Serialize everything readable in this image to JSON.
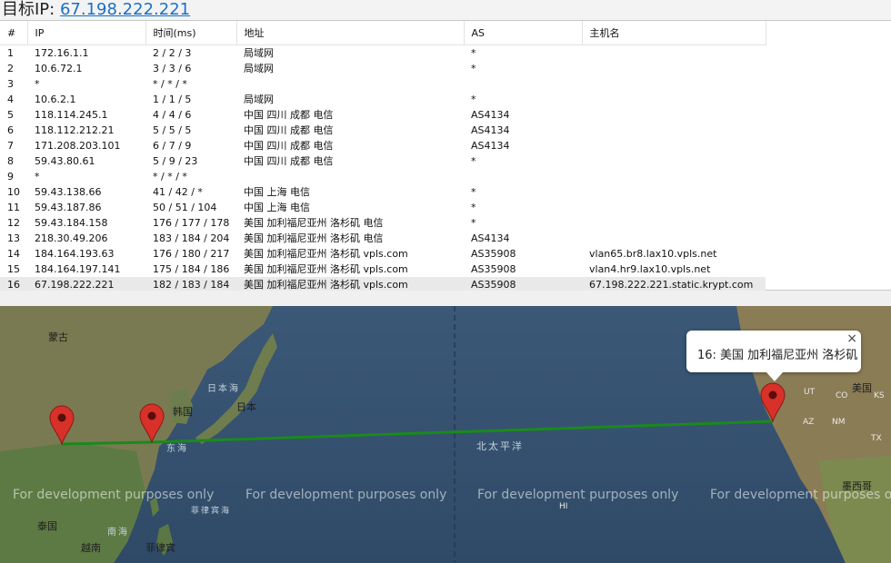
{
  "header": {
    "label": "目标IP:",
    "ip": "67.198.222.221"
  },
  "table": {
    "columns": [
      "#",
      "IP",
      "时间(ms)",
      "地址",
      "AS",
      "主机名"
    ],
    "rows": [
      [
        "1",
        "172.16.1.1",
        "2 / 2 / 3",
        "局域网",
        "*",
        ""
      ],
      [
        "2",
        "10.6.72.1",
        "3 / 3 / 6",
        "局域网",
        "*",
        ""
      ],
      [
        "3",
        "*",
        "* / * / *",
        "",
        "",
        ""
      ],
      [
        "4",
        "10.6.2.1",
        "1 / 1 / 5",
        "局域网",
        "*",
        ""
      ],
      [
        "5",
        "118.114.245.1",
        "4 / 4 / 6",
        "中国 四川 成都 电信",
        "AS4134",
        ""
      ],
      [
        "6",
        "118.112.212.21",
        "5 / 5 / 5",
        "中国 四川 成都 电信",
        "AS4134",
        ""
      ],
      [
        "7",
        "171.208.203.101",
        "6 / 7 / 9",
        "中国 四川 成都 电信",
        "AS4134",
        ""
      ],
      [
        "8",
        "59.43.80.61",
        "5 / 9 / 23",
        "中国 四川 成都 电信",
        "*",
        ""
      ],
      [
        "9",
        "*",
        "* / * / *",
        "",
        "",
        ""
      ],
      [
        "10",
        "59.43.138.66",
        "41 / 42 / *",
        "中国 上海 电信",
        "*",
        ""
      ],
      [
        "11",
        "59.43.187.86",
        "50 / 51 / 104",
        "中国 上海 电信",
        "*",
        ""
      ],
      [
        "12",
        "59.43.184.158",
        "176 / 177 / 178",
        "美国 加利福尼亚州 洛杉矶 电信",
        "*",
        ""
      ],
      [
        "13",
        "218.30.49.206",
        "183 / 184 / 204",
        "美国 加利福尼亚州 洛杉矶 电信",
        "AS4134",
        ""
      ],
      [
        "14",
        "184.164.193.63",
        "176 / 180 / 217",
        "美国 加利福尼亚州 洛杉矶 vpls.com",
        "AS35908",
        "vlan65.br8.lax10.vpls.net"
      ],
      [
        "15",
        "184.164.197.141",
        "175 / 184 / 186",
        "美国 加利福尼亚州 洛杉矶 vpls.com",
        "AS35908",
        "vlan4.hr9.lax10.vpls.net"
      ],
      [
        "16",
        "67.198.222.221",
        "182 / 183 / 184",
        "美国 加利福尼亚州 洛杉矶 vpls.com",
        "AS35908",
        "67.198.222.221.static.krypt.com"
      ]
    ]
  },
  "map": {
    "labels": {
      "mongolia": "蒙古",
      "korea": "韩国",
      "japan": "日本",
      "sea_of_japan": "日本海",
      "east_sea": "东海",
      "north_pacific": "北太平洋",
      "thailand": "泰国",
      "south_sea": "南海",
      "vietnam": "越南",
      "philippines": "菲律宾",
      "usa": "美国",
      "mexico": "墨西哥",
      "ut": "UT",
      "co": "CO",
      "ks": "KS",
      "az": "AZ",
      "nm": "NM",
      "tx": "TX",
      "philippine_sea": "菲律宾海",
      "hi": "HI"
    },
    "watermark": "For development purposes only",
    "popup": {
      "text": "16: 美国 加利福尼亚州 洛杉矶",
      "close": "×"
    },
    "route_color": "#1a8a1a",
    "marker_color": "#d8312a"
  }
}
